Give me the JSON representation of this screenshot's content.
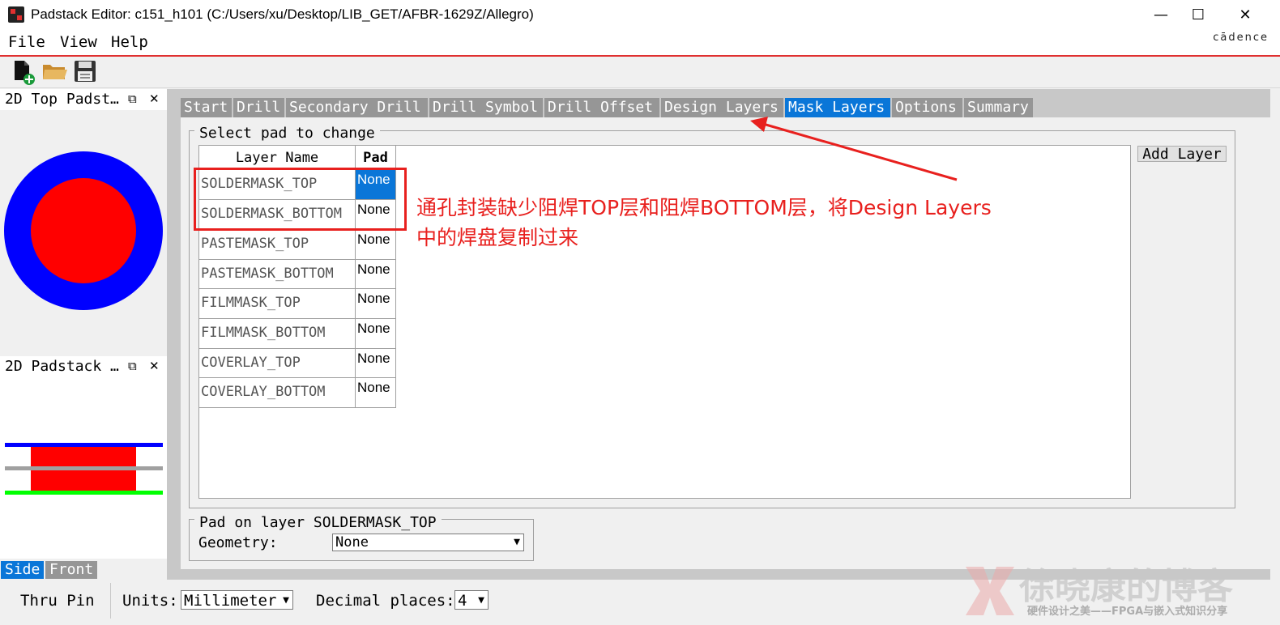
{
  "window": {
    "title": "Padstack Editor: c151_h101  (C:/Users/xu/Desktop/LIB_GET/AFBR-1629Z/Allegro)",
    "minimize": "—",
    "maximize": "☐",
    "close": "✕",
    "brand": "cādence"
  },
  "menu": [
    "File",
    "View",
    "Help"
  ],
  "toolbar": {
    "icons": [
      "new-file-icon",
      "open-folder-icon",
      "save-icon"
    ]
  },
  "left_panels": {
    "top_view": {
      "title": "2D Top Padst…",
      "float": "⧉",
      "close": "✕",
      "outer_color": "#0000ff",
      "inner_color": "#ff0000"
    },
    "side_view": {
      "title": "2D Padstack …",
      "float": "⧉",
      "close": "✕",
      "top_layer_color": "#0000ff",
      "mid_layer_color": "#a0a0a0",
      "bottom_layer_color": "#00ff00",
      "barrel_color": "#ff0000"
    },
    "view_tabs": [
      "Side",
      "Front"
    ],
    "active_view_tab": "Side"
  },
  "tabs": [
    "Start",
    "Drill",
    "Secondary Drill",
    "Drill Symbol",
    "Drill Offset",
    "Design Layers",
    "Mask Layers",
    "Options",
    "Summary"
  ],
  "active_tab": "Mask Layers",
  "select_pad": {
    "legend": "Select pad to change",
    "headers": {
      "layer": "Layer Name",
      "pad": "Pad"
    },
    "rows": [
      {
        "layer": "SOLDERMASK_TOP",
        "pad": "None"
      },
      {
        "layer": "SOLDERMASK_BOTTOM",
        "pad": "None"
      },
      {
        "layer": "PASTEMASK_TOP",
        "pad": "None"
      },
      {
        "layer": "PASTEMASK_BOTTOM",
        "pad": "None"
      },
      {
        "layer": "FILMMASK_TOP",
        "pad": "None"
      },
      {
        "layer": "FILMMASK_BOTTOM",
        "pad": "None"
      },
      {
        "layer": "COVERLAY_TOP",
        "pad": "None"
      },
      {
        "layer": "COVERLAY_BOTTOM",
        "pad": "None"
      }
    ],
    "add_layer": "Add Layer"
  },
  "pad_on_layer": {
    "legend": "Pad on layer SOLDERMASK_TOP",
    "geometry_label": "Geometry:",
    "geometry_value": "None"
  },
  "annotation": {
    "line1": "通孔封装缺少阻焊TOP层和阻焊BOTTOM层，将Design Layers",
    "line2": "中的焊盘复制过来",
    "color": "#e8201e"
  },
  "status": {
    "pin_type": "Thru Pin",
    "units_label": "Units:",
    "units_value": "Millimeter",
    "decimal_label": "Decimal places:",
    "decimal_value": "4"
  },
  "watermark": {
    "title": "徐晓康的博客",
    "subtitle": "硬件设计之美——FPGA与嵌入式知识分享"
  }
}
